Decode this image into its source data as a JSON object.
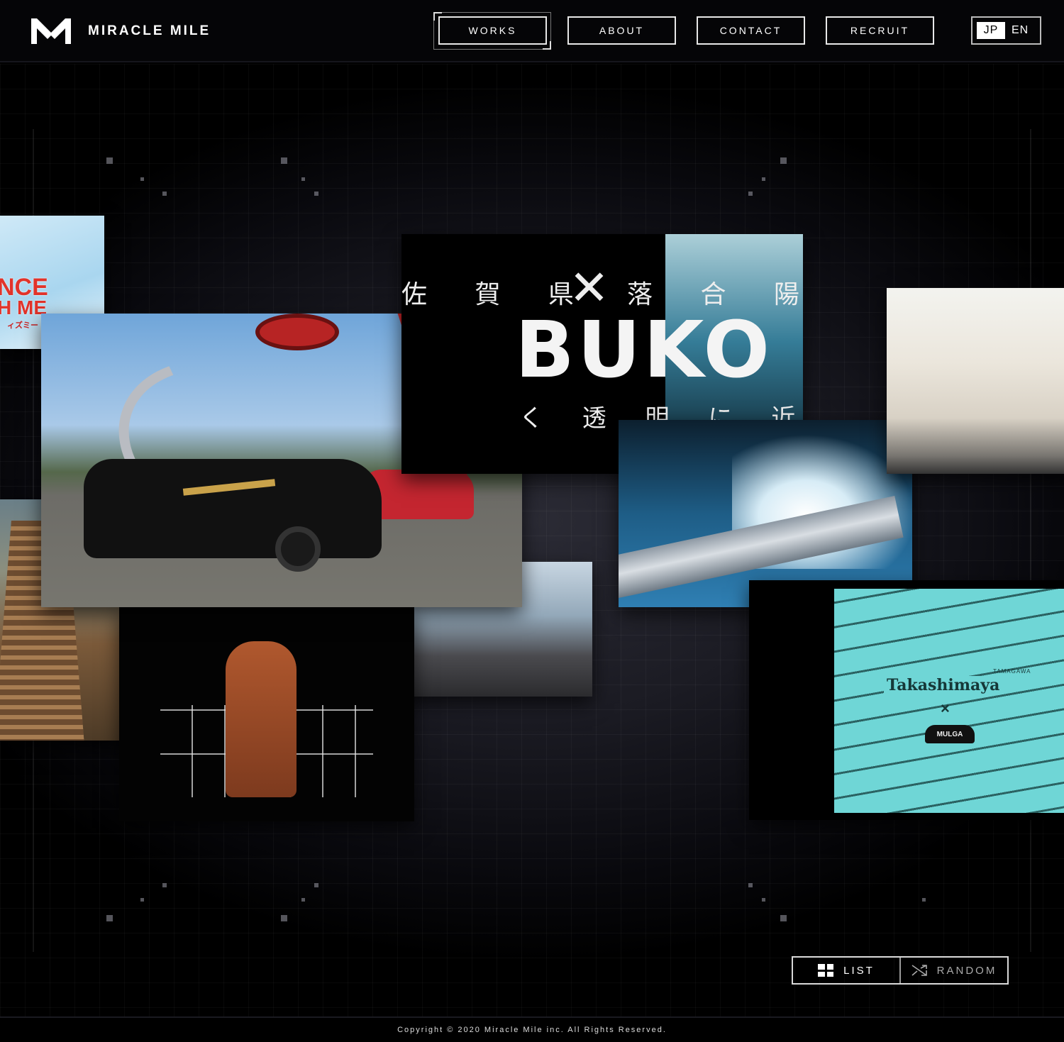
{
  "brand": {
    "name": "MIRACLE MILE",
    "logo_icon": "m-chevron-logo-icon"
  },
  "nav": {
    "items": [
      {
        "label": "WORKS",
        "active": true
      },
      {
        "label": "ABOUT",
        "active": false
      },
      {
        "label": "CONTACT",
        "active": false
      },
      {
        "label": "RECRUIT",
        "active": false
      }
    ]
  },
  "language": {
    "options": [
      "JP",
      "EN"
    ],
    "selected": "JP"
  },
  "works": {
    "buko": {
      "line1": "佐 賀 県",
      "line2": "落 合 陽 一",
      "title": "BUKO",
      "subtitle": "く 透 明 に 近 い イ カ"
    },
    "dance": {
      "line1": "NCE",
      "line2": "H ME",
      "line3": "ィズミー"
    },
    "takashimaya": {
      "brand": "Takashimaya",
      "branch": "TAMAGAWA",
      "separator": "×",
      "partner": "MULGA"
    }
  },
  "view_controls": {
    "list_label": "LIST",
    "random_label": "RANDOM"
  },
  "footer": {
    "copyright": "Copyright © 2020 Miracle Mile inc. All Rights Reserved."
  },
  "colors": {
    "background": "#000000",
    "header": "#050507",
    "nav_border": "#e8e8e8",
    "text": "#ffffff"
  }
}
